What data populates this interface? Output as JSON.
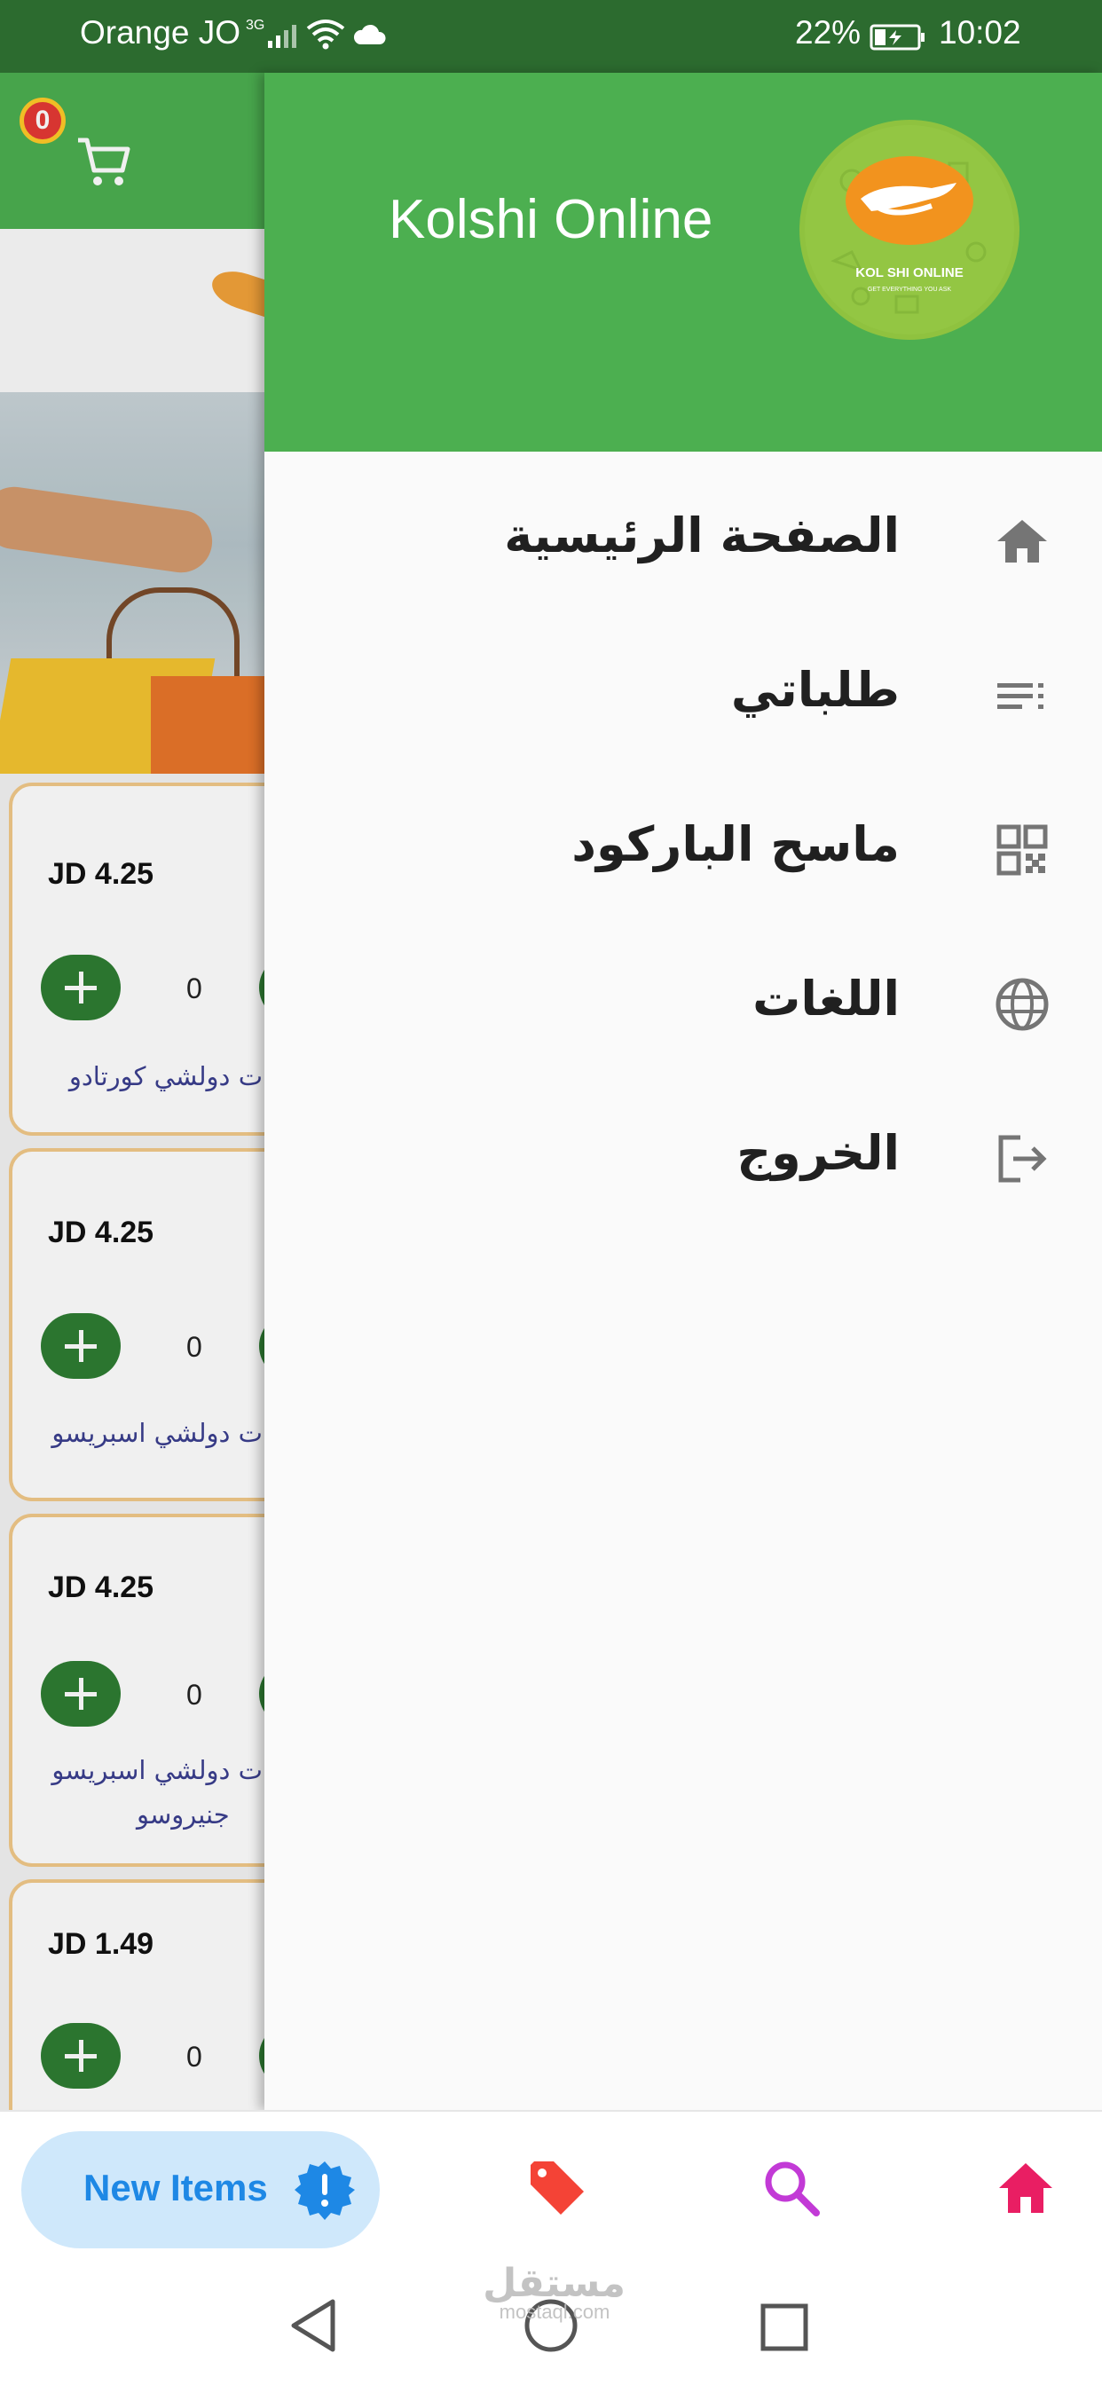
{
  "status_bar": {
    "carrier": "Orange JO",
    "network_type": "3G",
    "battery": "22%",
    "time": "10:02"
  },
  "background_app": {
    "cart_count": "0",
    "products": [
      {
        "price": "JD 4.25",
        "qty": "0",
        "name": "ت دولشي كورتادو",
        "name2": ""
      },
      {
        "price": "JD 4.25",
        "qty": "0",
        "name": "ت دولشي اسبريسو",
        "name2": ""
      },
      {
        "price": "JD 4.25",
        "qty": "0",
        "name": "ت دولشي اسبريسو",
        "name2": "جنيروسو"
      },
      {
        "price": "JD 1.49",
        "qty": "0",
        "name": "",
        "name2": ""
      }
    ]
  },
  "drawer": {
    "title": "Kolshi Online",
    "logo": {
      "text": "KOL SHI ONLINE",
      "tagline": "GET EVERYTHING YOU ASK"
    },
    "menu": [
      {
        "label": "الصفحة الرئيسية",
        "icon": "home-icon"
      },
      {
        "label": "طلباتي",
        "icon": "list-icon"
      },
      {
        "label": "ماسح الباركود",
        "icon": "qr-code-icon"
      },
      {
        "label": "اللغات",
        "icon": "globe-icon"
      },
      {
        "label": "الخروج",
        "icon": "logout-icon"
      }
    ]
  },
  "bottom_nav": {
    "new_items_label": "New Items",
    "icons": [
      "new-badge-icon",
      "tag-icon",
      "search-icon",
      "home-icon"
    ]
  },
  "watermark": {
    "arabic": "مستقل",
    "latin": "mostaql.com"
  },
  "colors": {
    "header_green": "#4caf50",
    "status_green": "#2c6b2f",
    "accent_blue": "#1e88e5",
    "tag_red": "#f44336",
    "search_purple": "#c23ad6",
    "home_pink": "#e91e63"
  }
}
